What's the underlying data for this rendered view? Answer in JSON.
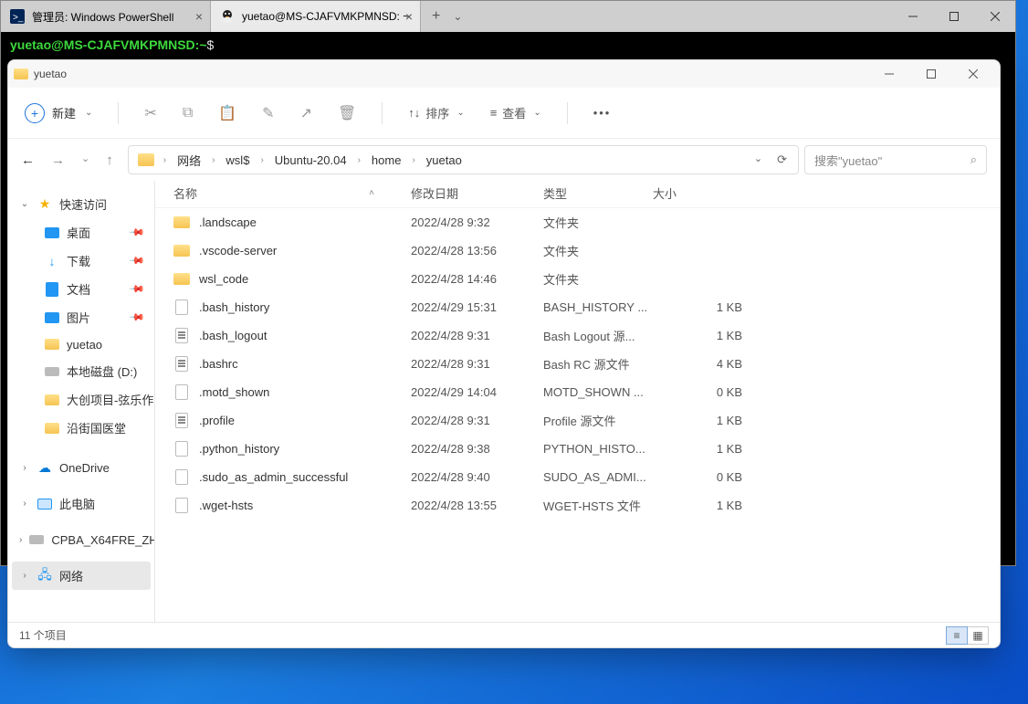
{
  "terminal": {
    "tabs": [
      {
        "title": "管理员: Windows PowerShell",
        "icon": "powershell-icon"
      },
      {
        "title": "yuetao@MS-CJAFVMKPMNSD: ~",
        "icon": "tux-icon"
      }
    ],
    "prompt_user_host": "yuetao@MS-CJAFVMKPMNSD:",
    "prompt_path": "~",
    "prompt_symbol": "$"
  },
  "explorer": {
    "title": "yuetao",
    "toolbar": {
      "new_label": "新建",
      "sort_label": "排序",
      "view_label": "查看"
    },
    "breadcrumb": [
      "网络",
      "wsl$",
      "Ubuntu-20.04",
      "home",
      "yuetao"
    ],
    "search_placeholder": "搜索\"yuetao\"",
    "sidebar": {
      "quick_access": "快速访问",
      "items": [
        {
          "label": "桌面",
          "pinned": true
        },
        {
          "label": "下载",
          "pinned": true
        },
        {
          "label": "文档",
          "pinned": true
        },
        {
          "label": "图片",
          "pinned": true
        },
        {
          "label": "yuetao"
        },
        {
          "label": "本地磁盘 (D:)"
        },
        {
          "label": "大创项目-弦乐作"
        },
        {
          "label": "沿街国医堂"
        }
      ],
      "onedrive": "OneDrive",
      "this_pc": "此电脑",
      "drive": "CPBA_X64FRE_ZH",
      "network": "网络"
    },
    "columns": {
      "name": "名称",
      "date": "修改日期",
      "type": "类型",
      "size": "大小"
    },
    "rows": [
      {
        "icon": "folder",
        "name": ".landscape",
        "date": "2022/4/28 9:32",
        "type": "文件夹",
        "size": ""
      },
      {
        "icon": "folder",
        "name": ".vscode-server",
        "date": "2022/4/28 13:56",
        "type": "文件夹",
        "size": ""
      },
      {
        "icon": "folder",
        "name": "wsl_code",
        "date": "2022/4/28 14:46",
        "type": "文件夹",
        "size": ""
      },
      {
        "icon": "file",
        "name": ".bash_history",
        "date": "2022/4/29 15:31",
        "type": "BASH_HISTORY ...",
        "size": "1 KB"
      },
      {
        "icon": "file2",
        "name": ".bash_logout",
        "date": "2022/4/28 9:31",
        "type": "Bash Logout 源...",
        "size": "1 KB"
      },
      {
        "icon": "file2",
        "name": ".bashrc",
        "date": "2022/4/28 9:31",
        "type": "Bash RC 源文件",
        "size": "4 KB"
      },
      {
        "icon": "file",
        "name": ".motd_shown",
        "date": "2022/4/29 14:04",
        "type": "MOTD_SHOWN ...",
        "size": "0 KB"
      },
      {
        "icon": "file2",
        "name": ".profile",
        "date": "2022/4/28 9:31",
        "type": "Profile 源文件",
        "size": "1 KB"
      },
      {
        "icon": "file",
        "name": ".python_history",
        "date": "2022/4/28 9:38",
        "type": "PYTHON_HISTO...",
        "size": "1 KB"
      },
      {
        "icon": "file",
        "name": ".sudo_as_admin_successful",
        "date": "2022/4/28 9:40",
        "type": "SUDO_AS_ADMI...",
        "size": "0 KB"
      },
      {
        "icon": "file",
        "name": ".wget-hsts",
        "date": "2022/4/28 13:55",
        "type": "WGET-HSTS 文件",
        "size": "1 KB"
      }
    ],
    "status": "11 个项目"
  }
}
